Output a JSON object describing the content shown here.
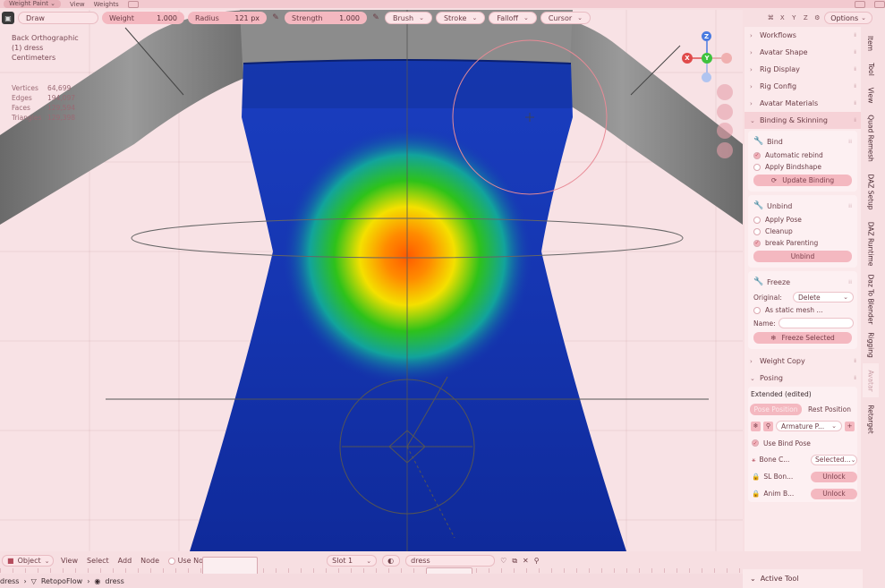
{
  "menubar": {
    "mode": "Weight Paint",
    "view": "View",
    "weights": "Weights"
  },
  "tool_header": {
    "brush_name": "Draw",
    "weight_label": "Weight",
    "weight_value": "1.000",
    "radius_label": "Radius",
    "radius_value": "121 px",
    "strength_label": "Strength",
    "strength_value": "1.000",
    "brush": "Brush",
    "stroke": "Stroke",
    "falloff": "Falloff",
    "cursor": "Cursor",
    "axis_x": "X",
    "axis_y": "Y",
    "axis_z": "Z",
    "options": "Options"
  },
  "viewport": {
    "view_name": "Back Orthographic",
    "object_name": "(1) dress",
    "units": "Centimeters",
    "stats": [
      {
        "label": "Vertices",
        "value": "64,699"
      },
      {
        "label": "Edges",
        "value": "194,097"
      },
      {
        "label": "Faces",
        "value": "129,594"
      },
      {
        "label": "Triangles",
        "value": "129,398"
      }
    ],
    "gizmo": {
      "x": "X",
      "y": "Y",
      "z": "Z"
    }
  },
  "npanel": {
    "sections": [
      {
        "label": "Workflows"
      },
      {
        "label": "Avatar Shape"
      },
      {
        "label": "Rig Display"
      },
      {
        "label": "Rig Config"
      },
      {
        "label": "Avatar Materials"
      },
      {
        "label": "Binding & Skinning"
      }
    ],
    "bind": {
      "title": "Bind",
      "automatic_rebind": "Automatic rebind",
      "apply_bindshape": "Apply Bindshape",
      "update_binding": "Update Binding"
    },
    "unbind": {
      "title": "Unbind",
      "apply_pose": "Apply Pose",
      "cleanup": "Cleanup",
      "break_parenting": "break Parenting",
      "unbind_btn": "Unbind"
    },
    "freeze": {
      "title": "Freeze",
      "original_label": "Original:",
      "original_value": "Delete",
      "as_static": "As static mesh ...",
      "name_label": "Name:",
      "freeze_selected": "Freeze Selected"
    },
    "weight_copy": "Weight Copy",
    "posing": {
      "title": "Posing",
      "mode": "Extended (edited)",
      "pose_position": "Pose Position",
      "rest_position": "Rest Position",
      "armature": "Armature P...",
      "use_bind_pose": "Use Bind Pose",
      "rows": [
        {
          "label": "Bone C...",
          "btn": "Selected..."
        },
        {
          "label": "SL Bon...",
          "btn": "Unlock"
        },
        {
          "label": "Anim B...",
          "btn": "Unlock"
        }
      ]
    }
  },
  "vertical_tabs": [
    "Item",
    "Tool",
    "View",
    "Quad Remesh",
    "DAZ Setup",
    "DAZ Runtime",
    "Daz To Blender",
    "Rigging",
    "Avatar",
    "Retarget"
  ],
  "bottom_header": {
    "mode": "Object",
    "view": "View",
    "select": "Select",
    "add": "Add",
    "node": "Node",
    "use_nodes": "Use Nodes",
    "slot": "Slot 1",
    "material": "dress"
  },
  "breadcrumb": {
    "item1": "dress",
    "item2": "RetopoFlow",
    "item3": "dress"
  },
  "active_tool": {
    "label": "Active Tool"
  }
}
